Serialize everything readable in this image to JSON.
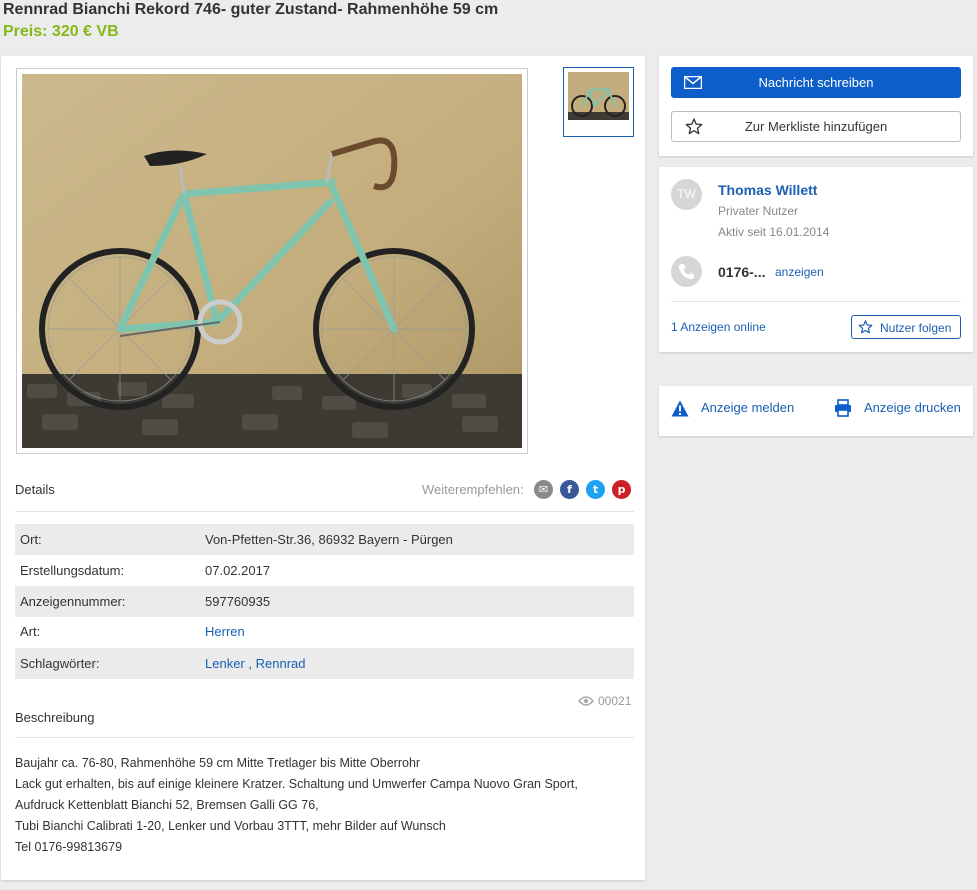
{
  "listing": {
    "title": "Rennrad Bianchi Rekord 746- guter Zustand- Rahmenhöhe 59 cm",
    "price": "Preis: 320 € VB"
  },
  "details": {
    "heading": "Details",
    "share_label": "Weiterempfehlen:",
    "share_icons": [
      "email-icon",
      "facebook-icon",
      "twitter-icon",
      "pinterest-icon"
    ],
    "rows": [
      {
        "label": "Ort:",
        "value": "Von-Pfetten-Str.36, 86932 Bayern - Pürgen"
      },
      {
        "label": "Erstellungsdatum:",
        "value": "07.02.2017"
      },
      {
        "label": "Anzeigennummer:",
        "value": "597760935"
      },
      {
        "label": "Art:",
        "value": "Herren"
      },
      {
        "label": "Schlagwörter:",
        "value": "Lenker",
        "value2": "Rennrad",
        "sep": ","
      }
    ],
    "views": "00021"
  },
  "description": {
    "heading": "Beschreibung",
    "lines": [
      "Baujahr ca. 76-80, Rahmenhöhe 59 cm Mitte Tretlager bis Mitte Oberrohr",
      "Lack gut erhalten, bis auf einige kleinere Kratzer. Schaltung und Umwerfer Campa Nuovo Gran Sport,",
      "Aufdruck Kettenblatt Bianchi 52, Bremsen Galli GG 76,",
      "Tubi Bianchi Calibrati 1-20, Lenker und Vorbau 3TTT, mehr Bilder auf Wunsch",
      "Tel 0176-99813679"
    ]
  },
  "actions": {
    "message": "Nachricht schreiben",
    "watchlist": "Zur Merkliste hinzufügen"
  },
  "seller": {
    "initials": "TW",
    "name": "Thomas Willett",
    "type": "Privater Nutzer",
    "active_since": "Aktiv seit 16.01.2014",
    "phone": "0176-...",
    "phone_reveal": "anzeigen",
    "ads_online": "1 Anzeigen online",
    "follow": "Nutzer folgen"
  },
  "footer_actions": {
    "report": "Anzeige melden",
    "print": "Anzeige drucken"
  },
  "colors": {
    "accent": "#0d5ec9",
    "link": "#1a5fb4",
    "price": "#86b817",
    "bike_paint": "#7fc4ae",
    "wall": "#c9b486"
  }
}
